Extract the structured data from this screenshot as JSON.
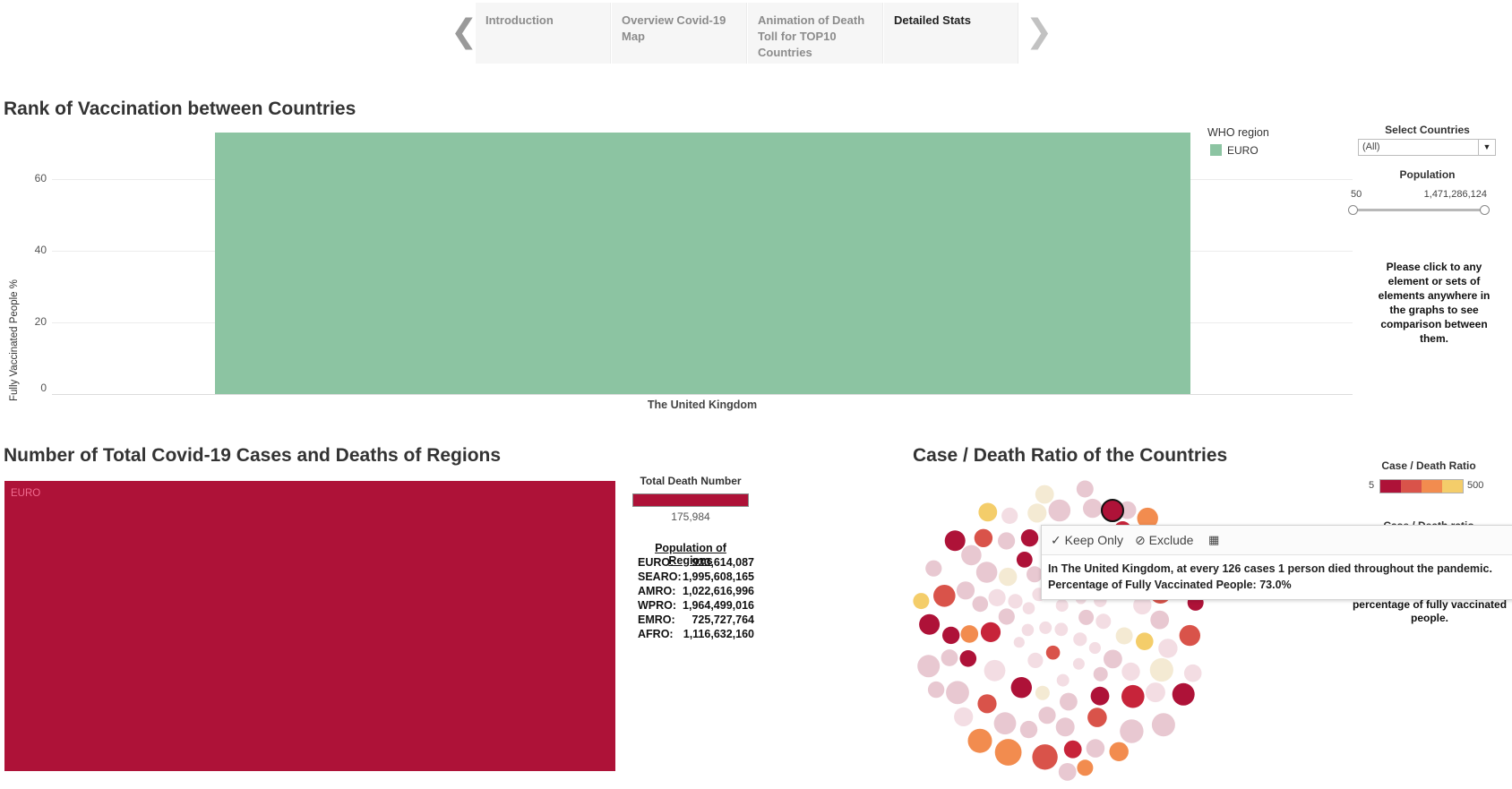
{
  "story": {
    "tabs": [
      {
        "label": "Introduction"
      },
      {
        "label": "Overview Covid-19 Map"
      },
      {
        "label": "Animation of Death Toll for TOP10 Countries"
      },
      {
        "label": "Detailed Stats"
      }
    ],
    "active_index": 3
  },
  "vaccination_chart": {
    "title": "Rank of Vaccination between Countries",
    "chart_data": {
      "type": "bar",
      "categories": [
        "The United Kingdom"
      ],
      "values": [
        73.0
      ],
      "ylabel": "Fully Vaccinated People %",
      "ylim": [
        0,
        75
      ],
      "yticks": [
        0,
        20,
        40,
        60
      ],
      "bar_color": "#8cc4a2"
    },
    "legend": {
      "title": "WHO region",
      "items": [
        {
          "label": "EURO",
          "color": "#8cc4a2"
        }
      ]
    }
  },
  "filters": {
    "select_countries": {
      "title": "Select Countries",
      "value": "(All)"
    },
    "population": {
      "title": "Population",
      "min": "50",
      "max": "1,471,286,124"
    },
    "note": "Please click to any element or sets of elements anywhere in the graphs to see comparison between them."
  },
  "regions_chart": {
    "title": "Number of Total Covid-19 Cases and Deaths of Regions",
    "tile_label": "EURO",
    "tile_color": "#ae1238",
    "death_legend": {
      "title": "Total Death Number",
      "value": "175,984"
    },
    "population": {
      "title": "Population of Regions",
      "rows": [
        {
          "region": "EURO:",
          "value": "933,614,087"
        },
        {
          "region": "SEARO:",
          "value": "1,995,608,165"
        },
        {
          "region": "AMRO:",
          "value": "1,022,616,996"
        },
        {
          "region": "WPRO:",
          "value": "1,964,499,016"
        },
        {
          "region": "EMRO:",
          "value": "725,727,764"
        },
        {
          "region": "AFRO:",
          "value": "1,116,632,160"
        }
      ]
    }
  },
  "ratio_chart": {
    "title": "Case / Death Ratio of the Countries",
    "legend": {
      "title": "Case / Death Ratio",
      "min": "5",
      "max": "500",
      "colors": [
        "#ae1238",
        "#d9534a",
        "#f28c4f",
        "#f4cd6a"
      ]
    },
    "partial_title": "Case / Death ratio",
    "note": "percentage of fully vaccinated people."
  },
  "tooltip": {
    "keep_only": "Keep Only",
    "exclude": "Exclude",
    "line1": "In The United Kingdom, at every  126 cases 1 person died throughout the pandemic.",
    "line2": "Percentage of Fully Vaccinated People: 73.0%"
  }
}
